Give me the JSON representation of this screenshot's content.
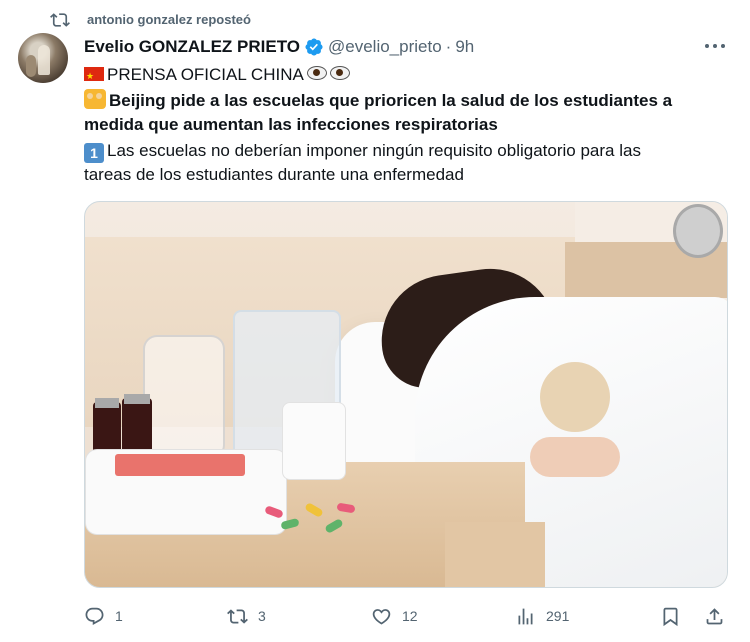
{
  "repost": {
    "text": "antonio gonzalez reposteó",
    "icon": "repost-icon"
  },
  "tweet": {
    "author_name": "Evelio GONZALEZ PRIETO",
    "verified_icon": "verified-badge-icon",
    "handle": "@evelio_prieto",
    "separator": "·",
    "time": "9h",
    "more_icon": "more-options-icon",
    "line1_text": "PRENSA OFICIAL CHINA",
    "line1_icons": [
      "china-flag-icon",
      "eye-icon",
      "eye-icon"
    ],
    "headline_icon": "children-icon",
    "headline_line1": "Beijing pide a las escuelas que prioricen la salud de los estudiantes a",
    "headline_line2": "medida que aumentan las infecciones respiratorias",
    "point_icon": "keycap-one-icon",
    "point_number": "1",
    "point_line1": "Las escuelas no deberían imponer ningún requisito obligatorio para las",
    "point_line2": "tareas de los estudiantes durante una enfermedad",
    "media_description_icon": "photo-sick-child-medicines"
  },
  "actions": {
    "reply": {
      "icon": "reply-icon",
      "count": "1"
    },
    "repost": {
      "icon": "repost-icon",
      "count": "3"
    },
    "like": {
      "icon": "like-icon",
      "count": "12"
    },
    "views": {
      "icon": "views-icon",
      "count": "291"
    },
    "bookmark": {
      "icon": "bookmark-icon"
    },
    "share": {
      "icon": "share-icon"
    }
  },
  "colors": {
    "text_primary": "#0f1419",
    "text_secondary": "#536471",
    "verified_blue": "#1d9bf0",
    "border": "#cfd9de"
  }
}
